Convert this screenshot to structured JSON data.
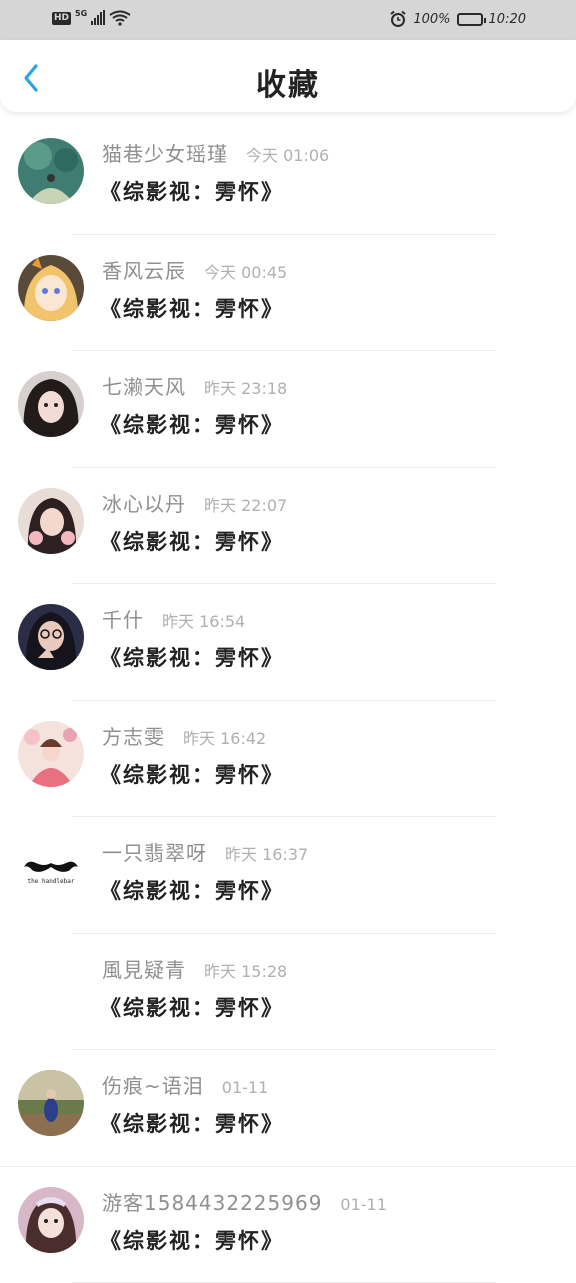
{
  "status_bar": {
    "hd": "HD",
    "network": "5G",
    "battery": "100%",
    "time": "10:20"
  },
  "header": {
    "title": "收藏"
  },
  "favorites": [
    {
      "name": "猫巷少女瑶瑾",
      "time": "今天 01:06",
      "content": "《综影视：雱怀》",
      "avatar_color": "#3f7d73"
    },
    {
      "name": "香风云辰",
      "time": "今天 00:45",
      "content": "《综影视：雱怀》",
      "avatar_color": "#f1c36a"
    },
    {
      "name": "七濑天风",
      "time": "昨天 23:18",
      "content": "《综影视：雱怀》",
      "avatar_color": "#3b3030"
    },
    {
      "name": "冰心以丹",
      "time": "昨天 22:07",
      "content": "《综影视：雱怀》",
      "avatar_color": "#c9a7a1"
    },
    {
      "name": "千什",
      "time": "昨天 16:54",
      "content": "《综影视：雱怀》",
      "avatar_color": "#2a2d45"
    },
    {
      "name": "方志雯",
      "time": "昨天 16:42",
      "content": "《综影视：雱怀》",
      "avatar_color": "#e9a0a6"
    },
    {
      "name": "一只翡翠呀",
      "time": "昨天 16:37",
      "content": "《综影视：雱怀》",
      "avatar_color": "#ffffff",
      "avatar_caption": "the handlebar"
    },
    {
      "name": "風見疑青",
      "time": "昨天 15:28",
      "content": "《综影视：雱怀》",
      "avatar_color": "#ffffff"
    },
    {
      "name": "伤痕~语泪",
      "time": "01-11",
      "content": "《综影视：雱怀》",
      "avatar_color": "#6b7a4a"
    },
    {
      "name": "游客1584432225969",
      "time": "01-11",
      "content": "《综影视：雱怀》",
      "avatar_color": "#d8b8c8"
    }
  ]
}
